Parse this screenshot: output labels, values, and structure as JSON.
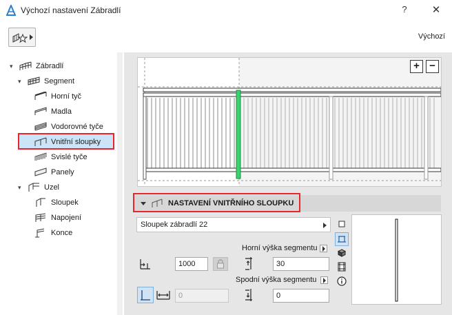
{
  "window": {
    "title": "Výchozí nastavení Zábradlí",
    "help_label": "?",
    "close_label": "✕"
  },
  "toolbar": {
    "favorites_icon": "star-railing-icon",
    "default_label": "Výchozí"
  },
  "tree": {
    "items": [
      {
        "label": "Zábradlí",
        "level": 0,
        "expanded": true,
        "icon": "railing-icon"
      },
      {
        "label": "Segment",
        "level": 1,
        "expanded": true,
        "icon": "segment-icon"
      },
      {
        "label": "Horní tyč",
        "level": 2,
        "icon": "top-rail-icon"
      },
      {
        "label": "Madla",
        "level": 2,
        "icon": "handrail-icon"
      },
      {
        "label": "Vodorovné tyče",
        "level": 2,
        "icon": "horizontal-rails-icon"
      },
      {
        "label": "Vnitřní sloupky",
        "level": 2,
        "icon": "inner-posts-icon",
        "selected": true
      },
      {
        "label": "Svislé tyče",
        "level": 2,
        "icon": "balusters-icon"
      },
      {
        "label": "Panely",
        "level": 2,
        "icon": "panels-icon"
      },
      {
        "label": "Uzel",
        "level": 1,
        "expanded": true,
        "icon": "node-icon"
      },
      {
        "label": "Sloupek",
        "level": 2,
        "icon": "post-icon"
      },
      {
        "label": "Napojení",
        "level": 2,
        "icon": "connection-icon"
      },
      {
        "label": "Konce",
        "level": 2,
        "icon": "ends-icon"
      }
    ]
  },
  "preview": {
    "zoom_in_label": "+",
    "zoom_out_label": "−"
  },
  "section": {
    "title": "NASTAVENÍ VNITŘNÍHO SLOUPKU"
  },
  "settings": {
    "profile": "Sloupek zábradlí 22",
    "top_height_label": "Horní výška segmentu",
    "bottom_height_label": "Spodní výška segmentu",
    "spacing_value": "1000",
    "top_height_value": "30",
    "offset_value": "0",
    "bottom_height_value": "0"
  },
  "colors": {
    "accent_outline": "#e8262a",
    "selection": "#cce4f7",
    "highlight_post": "#3cd26e"
  }
}
